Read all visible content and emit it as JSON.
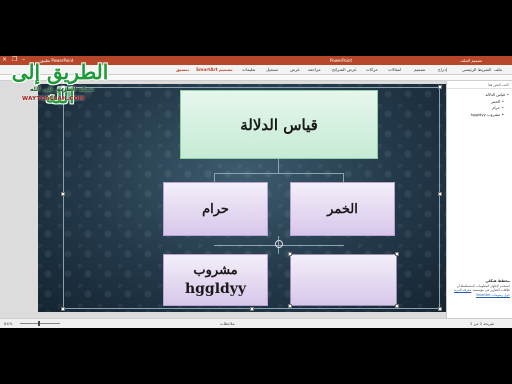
{
  "app": {
    "title_left": "تطبيق PowerPoint",
    "title_center": "PowerPoint",
    "title_right": "تصميم الملف"
  },
  "ribbon": {
    "tabs": [
      "ملف",
      "الشريط الرئيسي",
      "إدراج",
      "تصميم",
      "انتقالات",
      "حركات",
      "عرض الشرائح",
      "مراجعة",
      "عرض",
      "تسجيل",
      "تعليمات",
      "تصميم SmartArt",
      "تنسيق"
    ],
    "accent_tabs": [
      "تصميم SmartArt",
      "تنسيق"
    ]
  },
  "slide": {
    "top_box": "قياس الدلالة",
    "left_box": "حرام",
    "right_box": "الخمر",
    "bottom_left_line1": "مشروب",
    "bottom_left_line2": "hggldyy",
    "bottom_right": ""
  },
  "text_pane": {
    "header": "اكتب النص هنا",
    "items": [
      {
        "label": "قياس الدلالة",
        "level": 1
      },
      {
        "label": "الخمر",
        "level": 2
      },
      {
        "label": "حرام",
        "level": 2
      },
      {
        "label": "",
        "level": 2
      },
      {
        "label": "مشروب hggldyy",
        "level": 2
      }
    ],
    "desc_title": "مخطط هيكلي",
    "desc_body": "استخدم لإظهار المعلومات المتسلسلة أو علاقات التقارير في مؤسسة.",
    "desc_link": "معرفة المزيد حول رسومات SmartArt"
  },
  "status": {
    "slide_info": "شريحة 2 من 2",
    "notes": "ملاحظات",
    "zoom": "84%"
  },
  "watermark": {
    "main": "الطريق إلى الله",
    "sub": "شبكة الطريق إلى الله",
    "url": "WAYTOALLAH.COM"
  },
  "colors": {
    "titlebar": "#b7472a",
    "top_box": "#c6ebd4",
    "purple_box": "#d7c7ea",
    "slide_bg": "#23394a"
  }
}
